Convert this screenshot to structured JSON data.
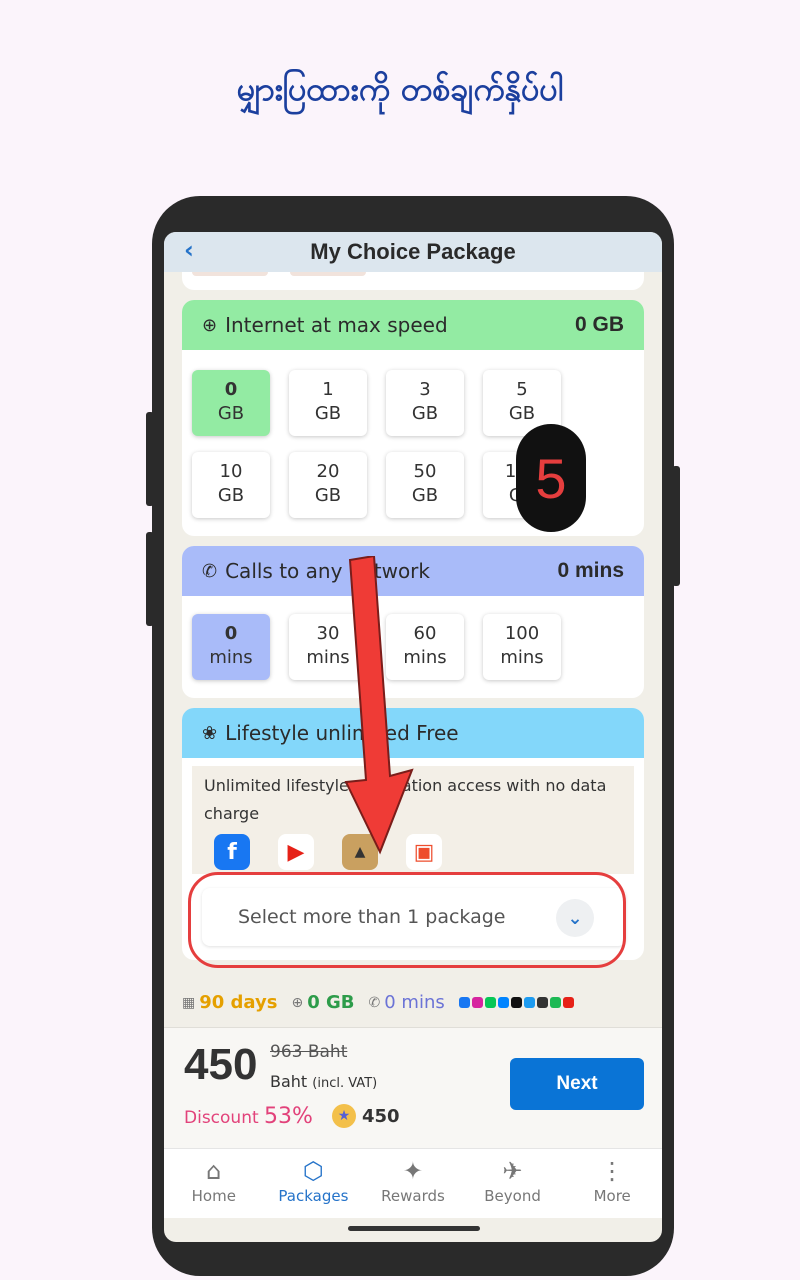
{
  "caption": "မျှားပြထားကို တစ်ချက်နှိပ်ပါ",
  "header": {
    "back": "‹",
    "title": "My Choice Package"
  },
  "internet": {
    "title": "Internet at max speed",
    "value": "0 GB",
    "options": [
      {
        "amount": "0",
        "unit": "GB"
      },
      {
        "amount": "1",
        "unit": "GB"
      },
      {
        "amount": "3",
        "unit": "GB"
      },
      {
        "amount": "5",
        "unit": "GB"
      },
      {
        "amount": "10",
        "unit": "GB"
      },
      {
        "amount": "20",
        "unit": "GB"
      },
      {
        "amount": "50",
        "unit": "GB"
      },
      {
        "amount": "100",
        "unit": "GB"
      }
    ]
  },
  "calls": {
    "title": "Calls to any network",
    "value": "0 mins",
    "options": [
      {
        "amount": "0",
        "unit": "mins"
      },
      {
        "amount": "30",
        "unit": "mins"
      },
      {
        "amount": "60",
        "unit": "mins"
      },
      {
        "amount": "100",
        "unit": "mins"
      }
    ]
  },
  "lifestyle": {
    "title": "Lifestyle unlimited Free",
    "description": "Unlimited lifestyle application access with no data charge",
    "select_label": "Select more than 1 package",
    "apps": [
      "facebook-icon",
      "youtube-icon",
      "pubg-icon",
      "shopee-icon"
    ]
  },
  "summary": {
    "days": "90 days",
    "gb": "0 GB",
    "mins": "0 mins"
  },
  "price": {
    "amount": "450",
    "old": "963 Baht",
    "currency": "Baht",
    "vat": "(incl. VAT)",
    "discount_label": "Discount",
    "discount_value": "53%",
    "points": "450",
    "next_label": "Next"
  },
  "nav": [
    {
      "label": "Home",
      "icon": "home-icon"
    },
    {
      "label": "Packages",
      "icon": "box-icon"
    },
    {
      "label": "Rewards",
      "icon": "gift-icon"
    },
    {
      "label": "Beyond",
      "icon": "plane-icon"
    },
    {
      "label": "More",
      "icon": "more-icon"
    }
  ],
  "step_badge": "5",
  "colors": {
    "accent": "#0a74d6",
    "highlight": "#e53e3e",
    "internet": "#93eba3",
    "calls": "#a9bbf9",
    "lifestyle": "#83d7fa"
  }
}
